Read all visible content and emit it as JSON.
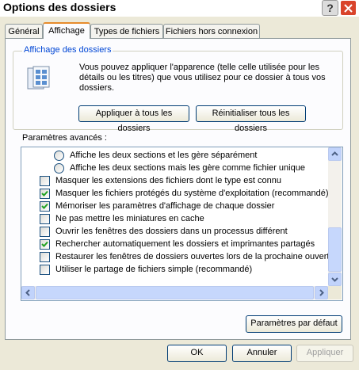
{
  "window": {
    "title": "Options des dossiers",
    "help_label": "?"
  },
  "tabs": [
    {
      "label": "Général"
    },
    {
      "label": "Affichage"
    },
    {
      "label": "Types de fichiers"
    },
    {
      "label": "Fichiers hors connexion"
    }
  ],
  "folder_view": {
    "group_title": "Affichage des dossiers",
    "description": "Vous pouvez appliquer l'apparence (telle celle utilisée pour les détails ou les titres) que vous utilisez pour ce dossier à tous vos dossiers.",
    "apply_all_label": "Appliquer à tous les dossiers",
    "reset_all_label": "Réinitialiser tous les dossiers"
  },
  "advanced": {
    "label": "Paramètres avancés :",
    "items": [
      {
        "kind": "radio",
        "checked": false,
        "label": "Affiche les deux sections et les gère séparément"
      },
      {
        "kind": "radio",
        "checked": false,
        "label": "Affiche les deux sections mais les gère comme fichier unique"
      },
      {
        "kind": "checkbox",
        "checked": false,
        "label": "Masquer les extensions des fichiers dont le type est connu"
      },
      {
        "kind": "checkbox",
        "checked": true,
        "label": "Masquer les fichiers protégés du système d'exploitation (recommandé)"
      },
      {
        "kind": "checkbox",
        "checked": true,
        "label": "Mémoriser les paramètres d'affichage de chaque dossier"
      },
      {
        "kind": "checkbox",
        "checked": false,
        "label": "Ne pas mettre les miniatures en cache"
      },
      {
        "kind": "checkbox",
        "checked": false,
        "label": "Ouvrir les fenêtres des dossiers dans un processus différent"
      },
      {
        "kind": "checkbox",
        "checked": true,
        "label": "Rechercher automatiquement les dossiers et imprimantes partagés"
      },
      {
        "kind": "checkbox",
        "checked": false,
        "label": "Restaurer les fenêtres de dossiers ouvertes lors de la prochaine ouverture"
      },
      {
        "kind": "checkbox",
        "checked": false,
        "label": "Utiliser le partage de fichiers simple (recommandé)"
      }
    ],
    "defaults_label": "Paramètres par défaut"
  },
  "footer": {
    "ok_label": "OK",
    "cancel_label": "Annuler",
    "apply_label": "Appliquer"
  },
  "colors": {
    "accent_tab": "#e68b2c",
    "group_title": "#0046d5",
    "close_button": "#d9442b",
    "dialog_bg": "#ece9d8"
  },
  "icons": [
    "folder-options-icon",
    "help-icon",
    "close-icon",
    "scroll-up-icon",
    "scroll-down-icon",
    "scroll-left-icon",
    "scroll-right-icon"
  ]
}
